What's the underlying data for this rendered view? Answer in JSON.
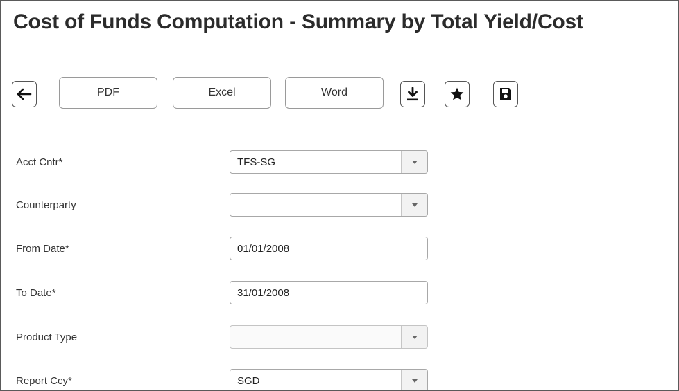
{
  "page": {
    "title": "Cost of Funds Computation - Summary by Total Yield/Cost"
  },
  "toolbar": {
    "back_icon": "arrow-left-icon",
    "pdf_label": "PDF",
    "excel_label": "Excel",
    "word_label": "Word",
    "download_icon": "download-icon",
    "favorite_icon": "star-icon",
    "save_icon": "floppy-disk-icon"
  },
  "form": {
    "acct_cntr": {
      "label": "Acct Cntr*",
      "value": "TFS-SG"
    },
    "counterparty": {
      "label": "Counterparty",
      "value": ""
    },
    "from_date": {
      "label": "From Date*",
      "value": "01/01/2008"
    },
    "to_date": {
      "label": "To Date*",
      "value": "31/01/2008"
    },
    "product_type": {
      "label": "Product Type",
      "value": ""
    },
    "report_ccy": {
      "label": "Report Ccy*",
      "value": "SGD"
    }
  }
}
